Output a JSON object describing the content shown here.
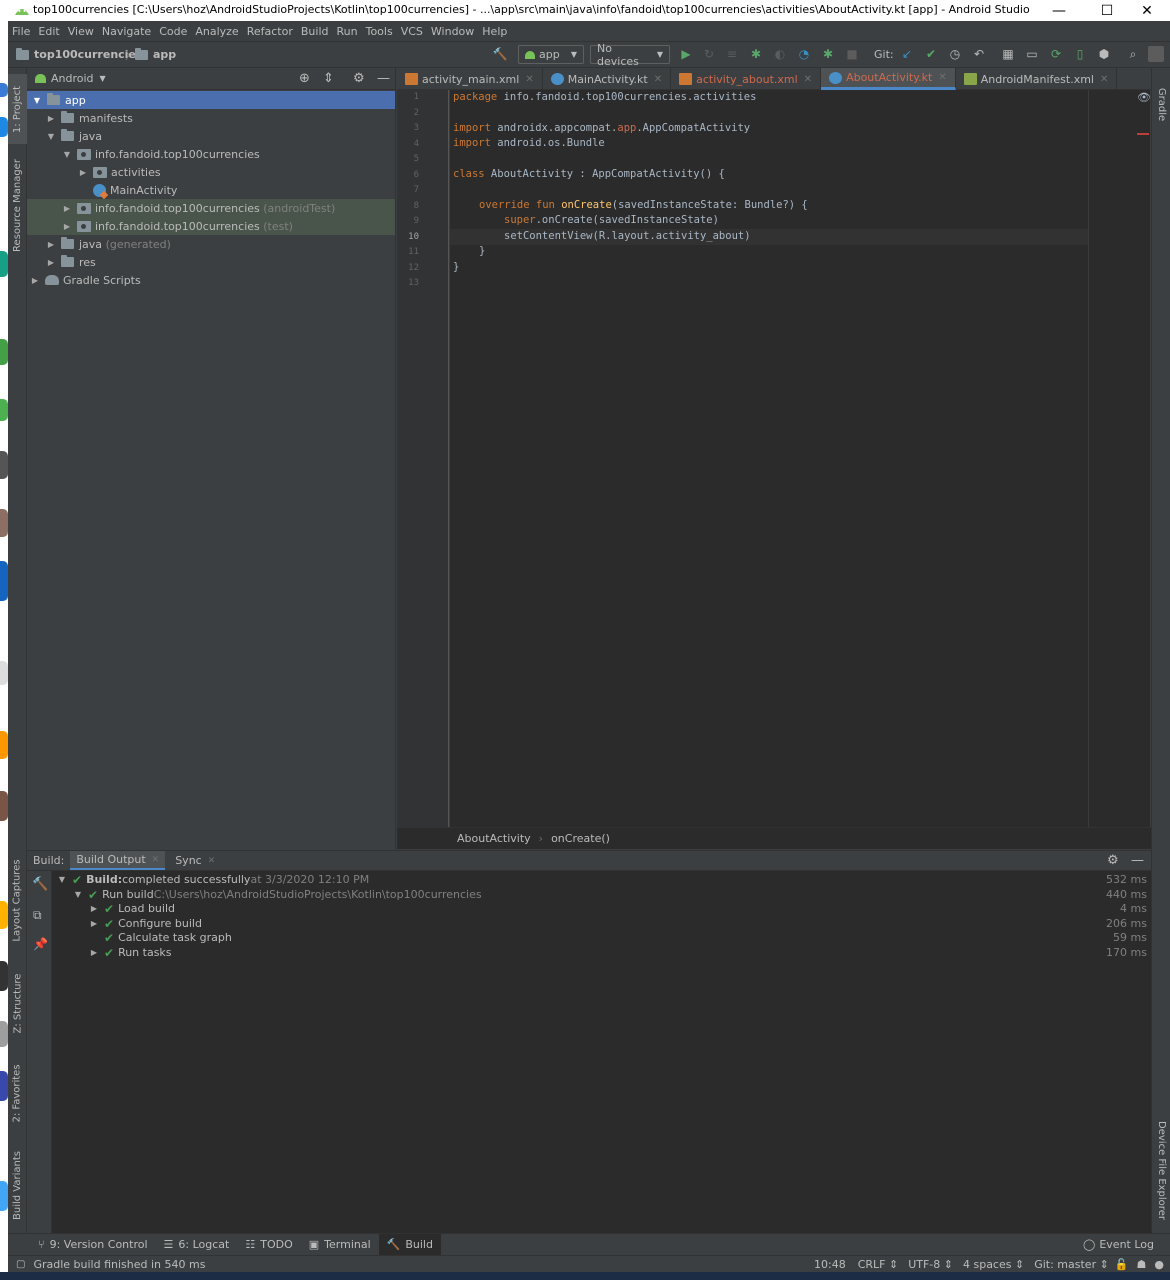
{
  "window": {
    "title": "top100currencies [C:\\Users\\hoz\\AndroidStudioProjects\\Kotlin\\top100currencies] - ...\\app\\src\\main\\java\\info\\fandoid\\top100currencies\\activities\\AboutActivity.kt [app] - Android Studio",
    "minimize": "—",
    "maximize": "☐",
    "close": "✕"
  },
  "menu": [
    "File",
    "Edit",
    "View",
    "Navigate",
    "Code",
    "Analyze",
    "Refactor",
    "Build",
    "Run",
    "Tools",
    "VCS",
    "Window",
    "Help"
  ],
  "navbar": {
    "project": "top100currencies",
    "module": "app",
    "run_config": "app",
    "device": "No devices",
    "git_label": "Git:"
  },
  "left_strip": {
    "project_tab": "1: Project",
    "resource_tab": "Resource Manager",
    "layout_tab": "Layout Captures",
    "structure_tab": "Z: Structure",
    "favorites_tab": "2: Favorites",
    "variants_tab": "Build Variants"
  },
  "right_strip": {
    "gradle_tab": "Gradle",
    "device_explorer_tab": "Device File Explorer"
  },
  "project_panel": {
    "view_mode": "Android",
    "tree": [
      {
        "label": "app"
      },
      {
        "label": "manifests"
      },
      {
        "label": "java"
      },
      {
        "label": "info.fandoid.top100currencies"
      },
      {
        "label": "activities"
      },
      {
        "label": "MainActivity"
      },
      {
        "label": "info.fandoid.top100currencies",
        "suffix": "(androidTest)"
      },
      {
        "label": "info.fandoid.top100currencies",
        "suffix": "(test)"
      },
      {
        "label": "java",
        "suffix": "(generated)"
      },
      {
        "label": "res"
      },
      {
        "label": "Gradle Scripts"
      }
    ]
  },
  "editor": {
    "tabs": [
      {
        "label": "activity_main.xml"
      },
      {
        "label": "MainActivity.kt"
      },
      {
        "label": "activity_about.xml"
      },
      {
        "label": "AboutActivity.kt"
      },
      {
        "label": "AndroidManifest.xml"
      }
    ],
    "line_numbers": [
      "1",
      "2",
      "3",
      "4",
      "5",
      "6",
      "7",
      "8",
      "9",
      "10",
      "11",
      "12",
      "13"
    ],
    "code": {
      "l1_kw": "package",
      "l1_rest": " info.fandoid.top100currencies.activities",
      "l3_kw": "import",
      "l3_a": " androidx.appcompat.",
      "l3_b": "app",
      "l3_c": ".AppCompatActivity",
      "l4_kw": "import",
      "l4_rest": " android.os.Bundle",
      "l6_kw": "class",
      "l6_rest": " AboutActivity : AppCompatActivity() {",
      "l8_kw1": "override",
      "l8_kw2": " fun",
      "l8_fn": " onCreate",
      "l8_rest": "(savedInstanceState: Bundle?) {",
      "l9_kw": "super",
      "l9_rest": ".onCreate(savedInstanceState)",
      "l10": "setContentView(R.layout.activity_about)",
      "l11": "}",
      "l12": "}"
    },
    "breadcrumb": [
      "AboutActivity",
      "onCreate()"
    ]
  },
  "build_panel": {
    "label": "Build:",
    "tabs": [
      "Build Output",
      "Sync"
    ],
    "rows": [
      {
        "bold": "Build:",
        "text": " completed successfully",
        "dim": " at 3/3/2020 12:10 PM",
        "time": "532 ms"
      },
      {
        "text": "Run build",
        "dim": " C:\\Users\\hoz\\AndroidStudioProjects\\Kotlin\\top100currencies",
        "time": "440 ms"
      },
      {
        "text": "Load build",
        "time": "4 ms"
      },
      {
        "text": "Configure build",
        "time": "206 ms"
      },
      {
        "text": "Calculate task graph",
        "time": "59 ms"
      },
      {
        "text": "Run tasks",
        "time": "170 ms"
      }
    ]
  },
  "bottom_tabs": [
    "9: Version Control",
    "6: Logcat",
    "TODO",
    "Terminal",
    "Build"
  ],
  "event_log": "Event Log",
  "status": {
    "message": "Gradle build finished in 540 ms",
    "position": "10:48",
    "line_sep": "CRLF ⇕",
    "encoding": "UTF-8 ⇕",
    "indent": "4 spaces ⇕",
    "branch": "Git: master ⇕"
  },
  "colors": {
    "accent": "#4a88c7",
    "success": "#499c54",
    "run": "#59a869"
  }
}
